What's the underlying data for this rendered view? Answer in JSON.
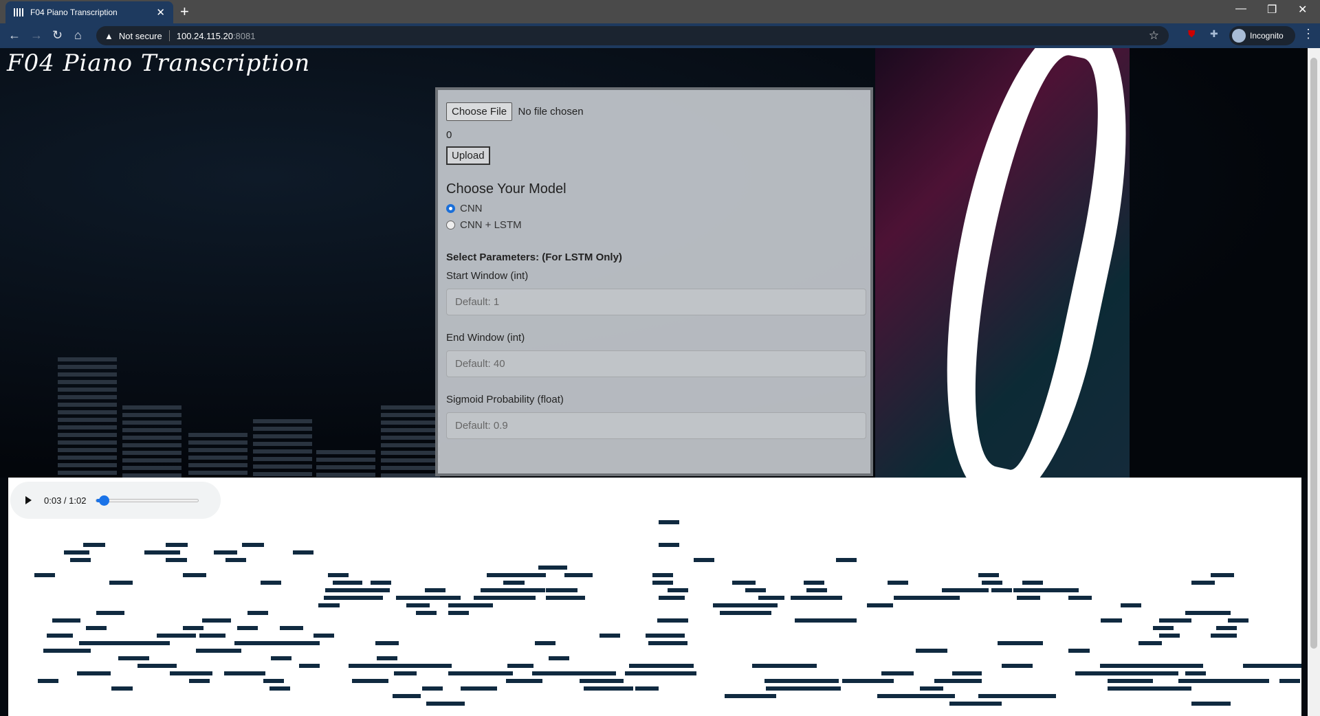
{
  "browser": {
    "tab_title": "F04 Piano Transcription",
    "new_tab": "+",
    "security": "Not secure",
    "url_host": "100.24.115.20",
    "url_port": ":8081",
    "profile": "Incognito"
  },
  "page": {
    "title": "F04 Piano Transcription"
  },
  "form": {
    "choose_file": "Choose File",
    "file_status": "No file chosen",
    "count": "0",
    "upload": "Upload",
    "model_heading": "Choose Your Model",
    "models": [
      {
        "label": "CNN",
        "selected": true
      },
      {
        "label": "CNN + LSTM",
        "selected": false
      }
    ],
    "params_heading": "Select Parameters: (For LSTM Only)",
    "fields": [
      {
        "label": "Start Window (int)",
        "placeholder": "Default: 1"
      },
      {
        "label": "End Window (int)",
        "placeholder": "Default: 40"
      },
      {
        "label": "Sigmoid Probability (float)",
        "placeholder": "Default: 0.9"
      }
    ]
  },
  "audio": {
    "time": "0:03 / 1:02",
    "progress": 0.05
  },
  "piano_roll": {
    "duration": 100,
    "pitches": 26,
    "notes": [
      [
        50.3,
        0,
        1.6
      ],
      [
        50.3,
        3,
        1.6
      ],
      [
        5.8,
        3,
        1.7
      ],
      [
        12.2,
        3,
        1.7
      ],
      [
        18.1,
        3,
        1.7
      ],
      [
        4.3,
        4,
        2
      ],
      [
        10.5,
        4,
        2.8
      ],
      [
        15.9,
        4,
        1.8
      ],
      [
        22,
        4,
        1.6
      ],
      [
        4.8,
        5,
        1.6
      ],
      [
        12.2,
        5,
        1.6
      ],
      [
        16.8,
        5,
        1.6
      ],
      [
        53,
        5,
        1.6
      ],
      [
        64,
        5,
        1.6
      ],
      [
        41,
        6,
        2.2
      ],
      [
        2,
        7,
        1.6
      ],
      [
        13.5,
        7,
        1.8
      ],
      [
        24.7,
        7,
        1.6
      ],
      [
        37,
        7,
        3
      ],
      [
        40,
        7,
        1.6
      ],
      [
        43,
        7,
        2.2
      ],
      [
        49.8,
        7,
        1.6
      ],
      [
        75,
        7,
        1.6
      ],
      [
        93,
        7,
        1.8
      ],
      [
        7.8,
        8,
        1.8
      ],
      [
        19.5,
        8,
        1.6
      ],
      [
        25.1,
        8,
        2.3
      ],
      [
        28,
        8,
        1.6
      ],
      [
        38.3,
        8,
        1.6
      ],
      [
        49.8,
        8,
        1.6
      ],
      [
        56,
        8,
        1.8
      ],
      [
        61.5,
        8,
        1.6
      ],
      [
        68,
        8,
        1.6
      ],
      [
        75.3,
        8,
        1.6
      ],
      [
        78.4,
        8,
        1.6
      ],
      [
        91.5,
        8,
        1.8
      ],
      [
        24.5,
        9,
        5
      ],
      [
        32.2,
        9,
        1.6
      ],
      [
        36.5,
        9,
        5
      ],
      [
        41.6,
        9,
        2.4
      ],
      [
        51,
        9,
        1.6
      ],
      [
        57,
        9,
        1.6
      ],
      [
        61.7,
        9,
        1.6
      ],
      [
        72.2,
        9,
        3.6
      ],
      [
        76,
        9,
        1.6
      ],
      [
        77.7,
        9,
        4.6
      ],
      [
        81.2,
        9,
        1.6
      ],
      [
        24.4,
        10,
        3
      ],
      [
        27,
        10,
        2
      ],
      [
        30,
        10,
        5
      ],
      [
        36,
        10,
        3.5
      ],
      [
        39,
        10,
        1.8
      ],
      [
        41.6,
        10,
        3
      ],
      [
        50.3,
        10,
        2
      ],
      [
        58,
        10,
        2
      ],
      [
        60.5,
        10,
        4
      ],
      [
        68.5,
        10,
        4
      ],
      [
        72,
        10,
        1.6
      ],
      [
        78,
        10,
        1.8
      ],
      [
        82,
        10,
        1.8
      ],
      [
        24,
        11,
        1.6
      ],
      [
        30.8,
        11,
        1.8
      ],
      [
        34,
        11,
        3.5
      ],
      [
        54.5,
        11,
        5
      ],
      [
        66.4,
        11,
        2
      ],
      [
        86,
        11,
        1.6
      ],
      [
        6.8,
        12,
        2.2
      ],
      [
        18.5,
        12,
        1.6
      ],
      [
        31.5,
        12,
        1.6
      ],
      [
        34,
        12,
        1.6
      ],
      [
        55,
        12,
        4
      ],
      [
        91,
        12,
        3.5
      ],
      [
        3.4,
        13,
        2.2
      ],
      [
        15,
        13,
        2.2
      ],
      [
        50.2,
        13,
        2.4
      ],
      [
        60.8,
        13,
        4.8
      ],
      [
        84.5,
        13,
        1.6
      ],
      [
        89,
        13,
        2.5
      ],
      [
        94.3,
        13,
        1.6
      ],
      [
        6,
        14,
        1.6
      ],
      [
        13.5,
        14,
        1.6
      ],
      [
        17.7,
        14,
        1.6
      ],
      [
        21,
        14,
        1.8
      ],
      [
        88.5,
        14,
        1.6
      ],
      [
        93.4,
        14,
        1.6
      ],
      [
        3,
        15,
        2
      ],
      [
        11.5,
        15,
        3
      ],
      [
        14.8,
        15,
        2
      ],
      [
        23.6,
        15,
        1.6
      ],
      [
        45.7,
        15,
        1.6
      ],
      [
        49.3,
        15,
        3
      ],
      [
        89,
        15,
        1.6
      ],
      [
        93,
        15,
        2
      ],
      [
        5.5,
        16,
        7
      ],
      [
        17.5,
        16,
        6.6
      ],
      [
        28.4,
        16,
        1.8
      ],
      [
        40.7,
        16,
        1.6
      ],
      [
        49.5,
        16,
        3
      ],
      [
        76.5,
        16,
        3.5
      ],
      [
        87.4,
        16,
        1.8
      ],
      [
        2.7,
        17,
        3.7
      ],
      [
        14.5,
        17,
        3.5
      ],
      [
        70.2,
        17,
        2.4
      ],
      [
        82,
        17,
        1.6
      ],
      [
        8.5,
        18,
        2.4
      ],
      [
        20.3,
        18,
        1.6
      ],
      [
        28.5,
        18,
        1.6
      ],
      [
        41.8,
        18,
        1.6
      ],
      [
        10,
        19,
        3
      ],
      [
        22.5,
        19,
        1.6
      ],
      [
        26.3,
        19,
        8
      ],
      [
        38.6,
        19,
        2
      ],
      [
        48,
        19,
        5
      ],
      [
        57.5,
        19,
        5
      ],
      [
        76.8,
        19,
        2.4
      ],
      [
        84.4,
        19,
        8
      ],
      [
        95.5,
        19,
        4.5
      ],
      [
        5.3,
        20,
        2.6
      ],
      [
        12.5,
        20,
        3.3
      ],
      [
        16.7,
        20,
        3.2
      ],
      [
        29.8,
        20,
        1.8
      ],
      [
        34,
        20,
        5
      ],
      [
        40.5,
        20,
        6.5
      ],
      [
        47.7,
        20,
        5.5
      ],
      [
        67.5,
        20,
        2.5
      ],
      [
        73,
        20,
        2.3
      ],
      [
        82.5,
        20,
        8
      ],
      [
        91,
        20,
        1.6
      ],
      [
        2.3,
        21,
        1.6
      ],
      [
        14,
        21,
        1.6
      ],
      [
        19.7,
        21,
        1.6
      ],
      [
        26.6,
        21,
        2.8
      ],
      [
        38.5,
        21,
        2.8
      ],
      [
        44.2,
        21,
        3.4
      ],
      [
        58.5,
        21,
        5.7
      ],
      [
        64.5,
        21,
        4
      ],
      [
        71.6,
        21,
        3
      ],
      [
        73.6,
        21,
        1.7
      ],
      [
        85,
        21,
        3.5
      ],
      [
        90.5,
        21,
        7
      ],
      [
        98.3,
        21,
        1.6
      ],
      [
        8,
        22,
        1.6
      ],
      [
        20.2,
        22,
        1.6
      ],
      [
        32,
        22,
        1.6
      ],
      [
        35,
        22,
        2.8
      ],
      [
        44.5,
        22,
        3.8
      ],
      [
        48.5,
        22,
        1.8
      ],
      [
        58.6,
        22,
        5.8
      ],
      [
        70.5,
        22,
        1.8
      ],
      [
        85,
        22,
        6.5
      ],
      [
        29.7,
        23,
        2.2
      ],
      [
        55.4,
        23,
        4
      ],
      [
        67.2,
        23,
        6
      ],
      [
        75,
        23,
        6
      ],
      [
        32.3,
        24,
        3
      ],
      [
        72.8,
        24,
        4
      ],
      [
        91.5,
        24,
        3
      ]
    ]
  }
}
